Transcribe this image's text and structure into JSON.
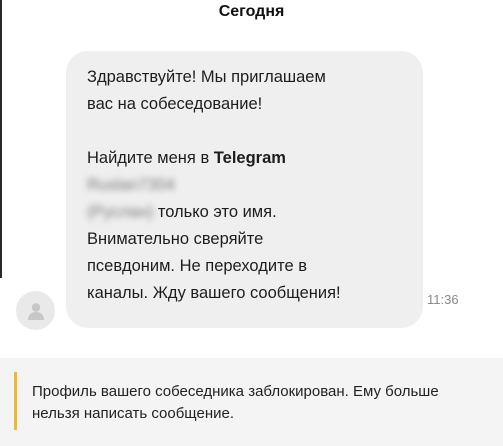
{
  "chat": {
    "date_label": "Сегодня",
    "message": {
      "line1": "Здравствуйте! Мы приглашаем",
      "line2": "вас на собеседование!",
      "find_prefix": "Найдите меня в ",
      "find_app": "Telegram",
      "blurred_handle": "Ruslan7304",
      "blurred_name": "(Руслан)",
      "only_name": " только это имя.",
      "line_a": "Внимательно сверяйте",
      "line_b": "псевдоним. Не переходите в",
      "line_c": "каналы. Жду вашего сообщения!",
      "time": "11:36"
    },
    "avatar_icon": "user-silhouette-icon"
  },
  "notice": {
    "text": "Профиль вашего собеседника заблокирован. Ему больше нельзя написать сообщение.",
    "accent_color": "#f2b632"
  }
}
